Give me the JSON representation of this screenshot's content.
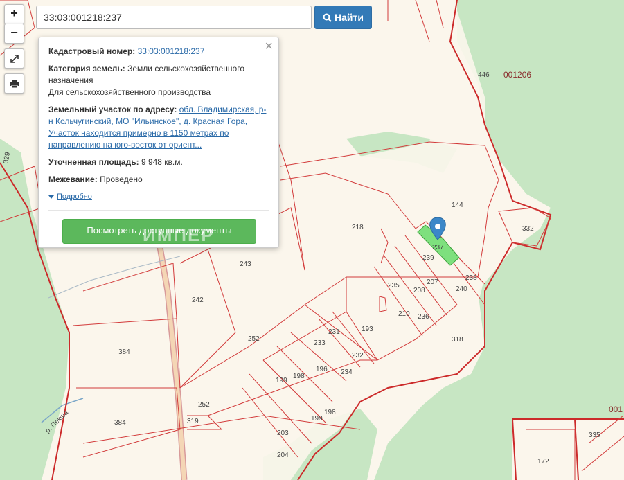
{
  "search": {
    "value": "33:03:001218:237",
    "button_label": "Найти"
  },
  "controls": {
    "zoom_in": "+",
    "zoom_out": "−"
  },
  "popup": {
    "cadastral_label": "Кадастровый номер:",
    "cadastral_value": "33:03:001218:237",
    "category_label": "Категория земель:",
    "category_value": "Земли сельскохозяйственного назначения",
    "category_use": "Для сельскохозяйственного производства",
    "address_label": "Земельный участок по адресу:",
    "address_value": "обл. Владимирская, р-н Кольчугинский, МО \"Ильинское\", д. Красная Гора, Участок находится примерно в 1150 метрах по направлению на юго-восток от ориент...",
    "area_label": "Уточненная площадь:",
    "area_value": "9 948 кв.м.",
    "survey_label": "Межевание:",
    "survey_value": "Проведено",
    "details_link": "Подробно",
    "docs_button": "Посмотреть доступные документы",
    "close": "×"
  },
  "watermark": "ИМПЕР",
  "map": {
    "parcel_labels": [
      "446",
      "144",
      "332",
      "218",
      "237",
      "239",
      "207",
      "240",
      "238",
      "235",
      "208",
      "210",
      "236",
      "243",
      "242",
      "193",
      "231",
      "233",
      "232",
      "196",
      "234",
      "318",
      "252",
      "199",
      "198",
      "384",
      "384",
      "252",
      "319",
      "199",
      "198",
      "203",
      "204",
      "335",
      "172",
      "329"
    ],
    "quarter_labels": [
      "001206",
      "001"
    ],
    "road_label": "р. Пекша"
  },
  "colors": {
    "forest": "#c7e6c3",
    "land": "#fbf6ec",
    "boundary": "#d23a3a",
    "selected": "#7ee07e",
    "marker": "#3b87c8"
  }
}
